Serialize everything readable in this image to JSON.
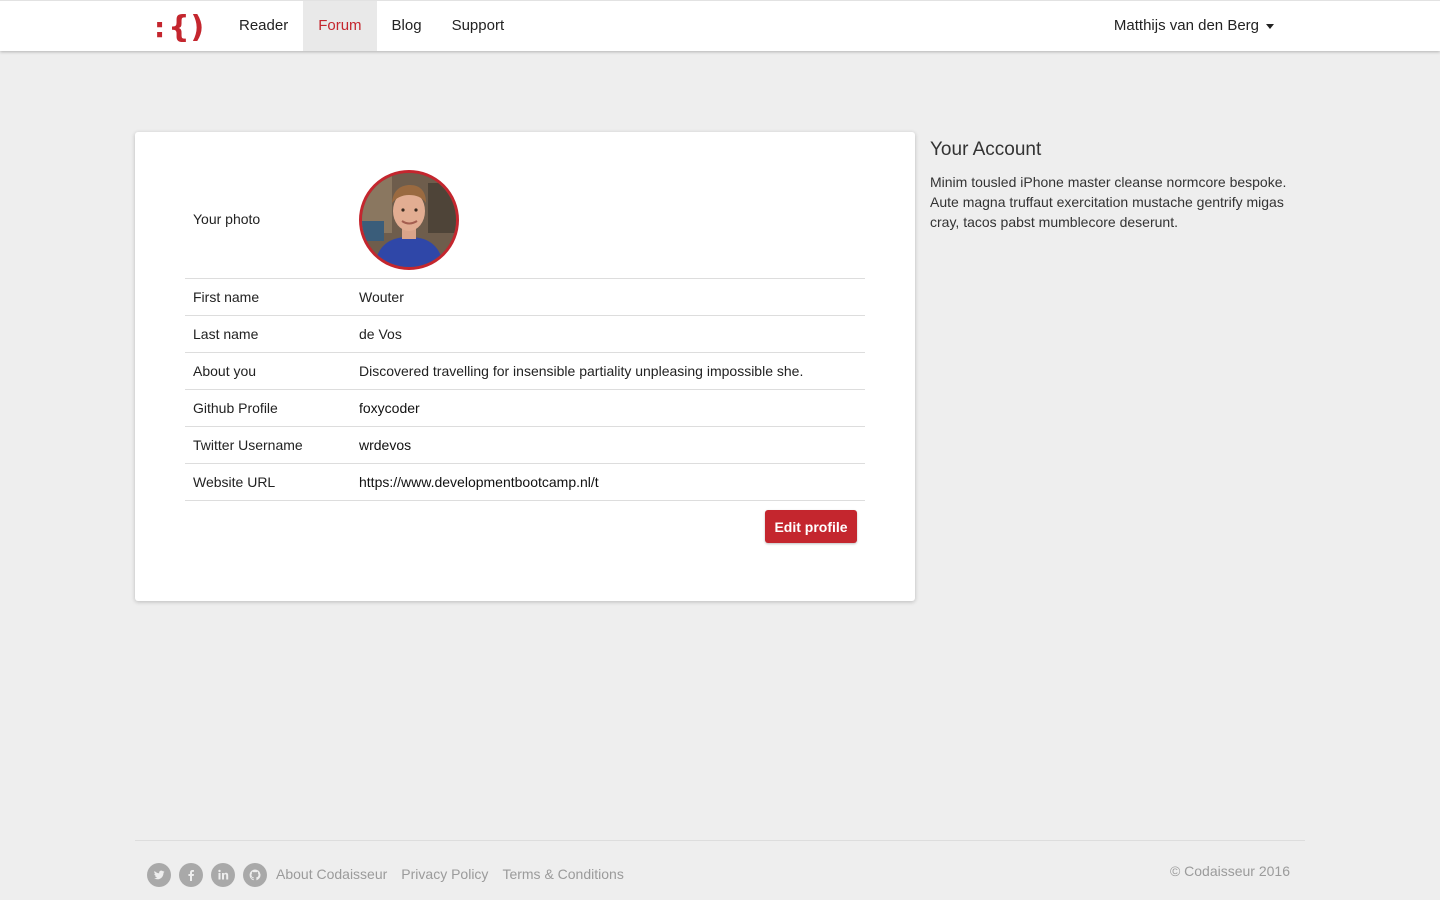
{
  "brand": {
    "logo_colon": ":",
    "logo_braces": "{)"
  },
  "nav": {
    "items": [
      {
        "label": "Reader"
      },
      {
        "label": "Forum",
        "active": true
      },
      {
        "label": "Blog"
      },
      {
        "label": "Support"
      }
    ],
    "user_name": "Matthijs van den Berg"
  },
  "profile": {
    "photo_label": "Your photo",
    "rows": [
      {
        "label": "First name",
        "value": "Wouter"
      },
      {
        "label": "Last name",
        "value": "de Vos"
      },
      {
        "label": "About you",
        "value": "Discovered travelling for insensible partiality unpleasing impossible she."
      },
      {
        "label": "Github Profile",
        "value": "foxycoder"
      },
      {
        "label": "Twitter Username",
        "value": "wrdevos"
      },
      {
        "label": "Website URL",
        "value": "https://www.developmentbootcamp.nl/t"
      }
    ],
    "edit_button": "Edit profile"
  },
  "sidebar": {
    "title": "Your Account",
    "text": "Minim tousled iPhone master cleanse normcore bespoke. Aute magna truffaut exercitation mustache gentrify migas cray, tacos pabst mumblecore deserunt."
  },
  "footer": {
    "social": [
      "twitter-icon",
      "facebook-icon",
      "linkedin-icon",
      "github-icon"
    ],
    "links": [
      "About Codaisseur",
      "Privacy Policy",
      "Terms & Conditions"
    ],
    "copyright": "© Codaisseur 2016"
  },
  "colors": {
    "accent": "#c4262e",
    "background": "#eeeeee"
  }
}
